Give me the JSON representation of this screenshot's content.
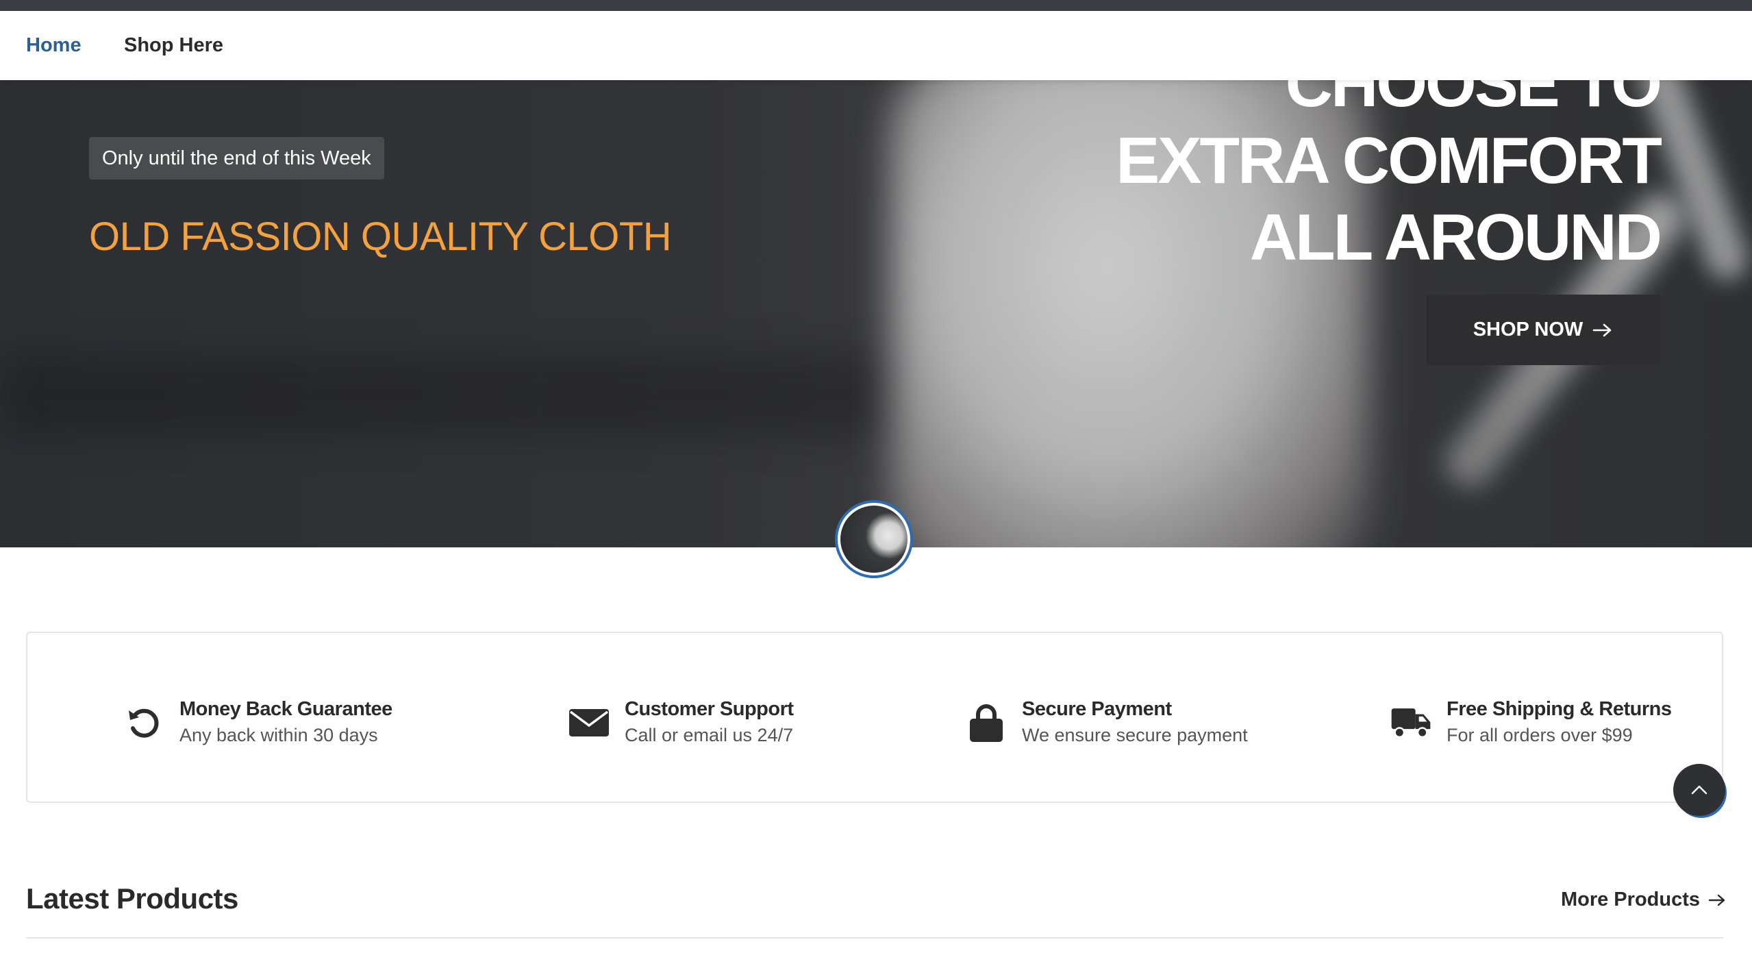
{
  "nav": {
    "home_label": "Home",
    "shop_label": "Shop Here"
  },
  "hero": {
    "badge": "Only until the end of this Week",
    "title": "OLD FASSION QUALITY CLOTH",
    "headline_partial": "CHOOSE TO",
    "headline_line1": "EXTRA COMFORT",
    "headline_line2": "ALL AROUND",
    "cta_label": "SHOP NOW",
    "cta_icon": "arrow-right-icon",
    "title_color": "#f3a23f"
  },
  "features": [
    {
      "icon": "undo-icon",
      "title": "Money Back Guarantee",
      "subtitle": "Any back within 30 days"
    },
    {
      "icon": "envelope-icon",
      "title": "Customer Support",
      "subtitle": "Call or email us 24/7"
    },
    {
      "icon": "lock-icon",
      "title": "Secure Payment",
      "subtitle": "We ensure secure payment"
    },
    {
      "icon": "truck-icon",
      "title": "Free Shipping & Returns",
      "subtitle": "For all orders over $99"
    }
  ],
  "latest": {
    "title": "Latest Products",
    "more_label": "More Products",
    "more_icon": "arrow-right-icon"
  },
  "colors": {
    "accent": "#2f6bb0",
    "dark": "#2e2e30"
  }
}
